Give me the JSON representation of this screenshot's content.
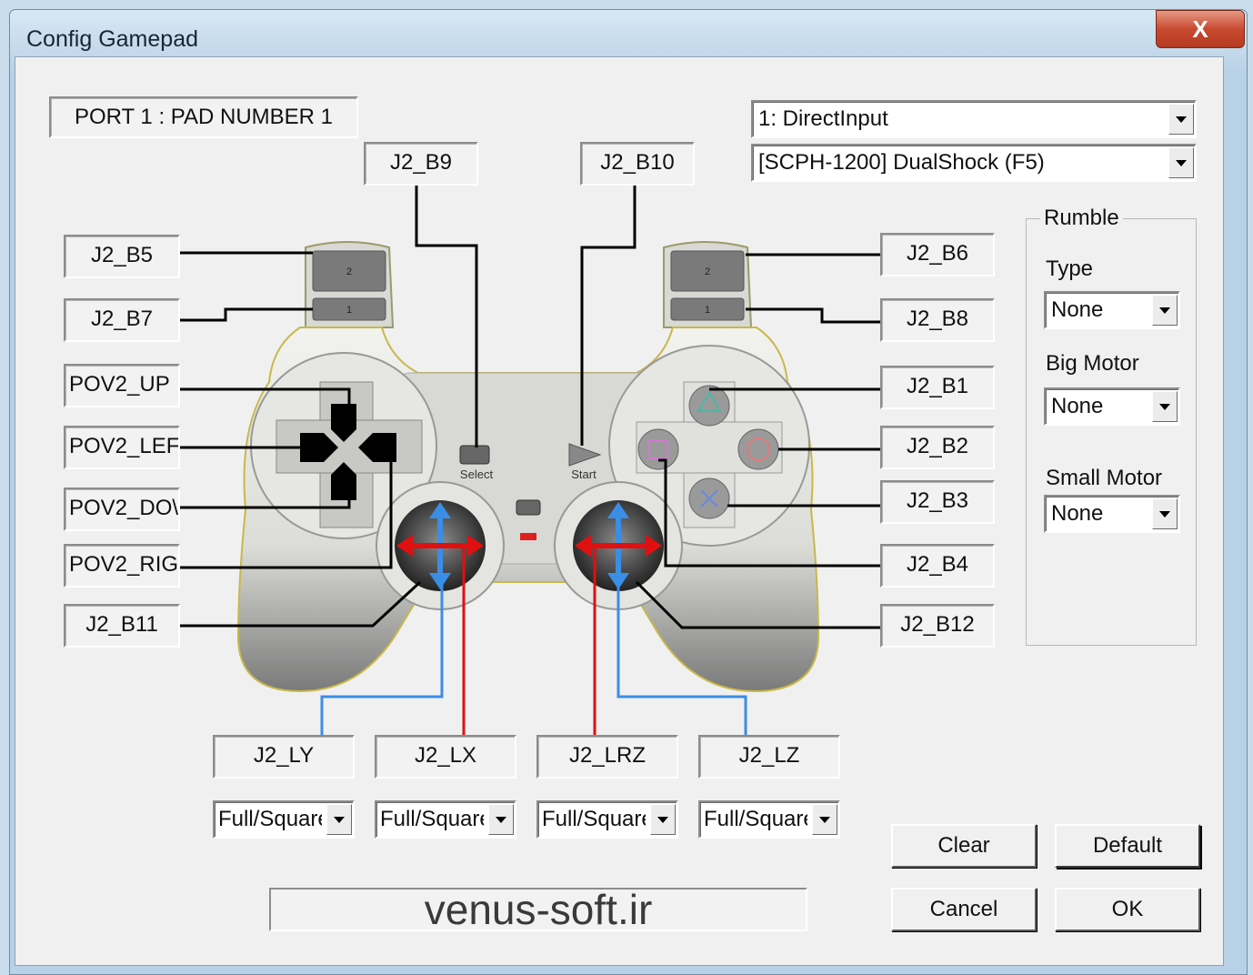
{
  "window": {
    "title": "Config Gamepad",
    "close_glyph": "X"
  },
  "port_label": "PORT 1 : PAD NUMBER 1",
  "api_combo": {
    "value": "1: DirectInput"
  },
  "pad_combo": {
    "value": "[SCPH-1200] DualShock (F5)"
  },
  "bindings": {
    "b9": "J2_B9",
    "b10": "J2_B10",
    "b5": "J2_B5",
    "b7": "J2_B7",
    "pov_up": "POV2_UP",
    "pov_left": "POV2_LEF",
    "pov_down": "POV2_DO\\",
    "pov_right": "POV2_RIG",
    "b11": "J2_B11",
    "b6": "J2_B6",
    "b8": "J2_B8",
    "b1": "J2_B1",
    "b2": "J2_B2",
    "b3": "J2_B3",
    "b4": "J2_B4",
    "b12": "J2_B12",
    "ly": "J2_LY",
    "lx": "J2_LX",
    "lrz": "J2_LRZ",
    "lz": "J2_LZ"
  },
  "controller": {
    "select_label": "Select",
    "start_label": "Start",
    "l2": "2",
    "l1": "1",
    "r2": "2",
    "r1": "1"
  },
  "axis_modes": [
    "Full/Square",
    "Full/Square",
    "Full/Square",
    "Full/Square"
  ],
  "rumble": {
    "title": "Rumble",
    "type_label": "Type",
    "type_value": "None",
    "big_label": "Big Motor",
    "big_value": "None",
    "small_label": "Small Motor",
    "small_value": "None"
  },
  "buttons": {
    "clear": "Clear",
    "default": "Default",
    "cancel": "Cancel",
    "ok": "OK"
  },
  "watermark": "venus-soft.ir",
  "colors": {
    "red_axis": "#e01010",
    "blue_axis": "#3a8ee6",
    "title_bar": "#b9d1e6"
  }
}
